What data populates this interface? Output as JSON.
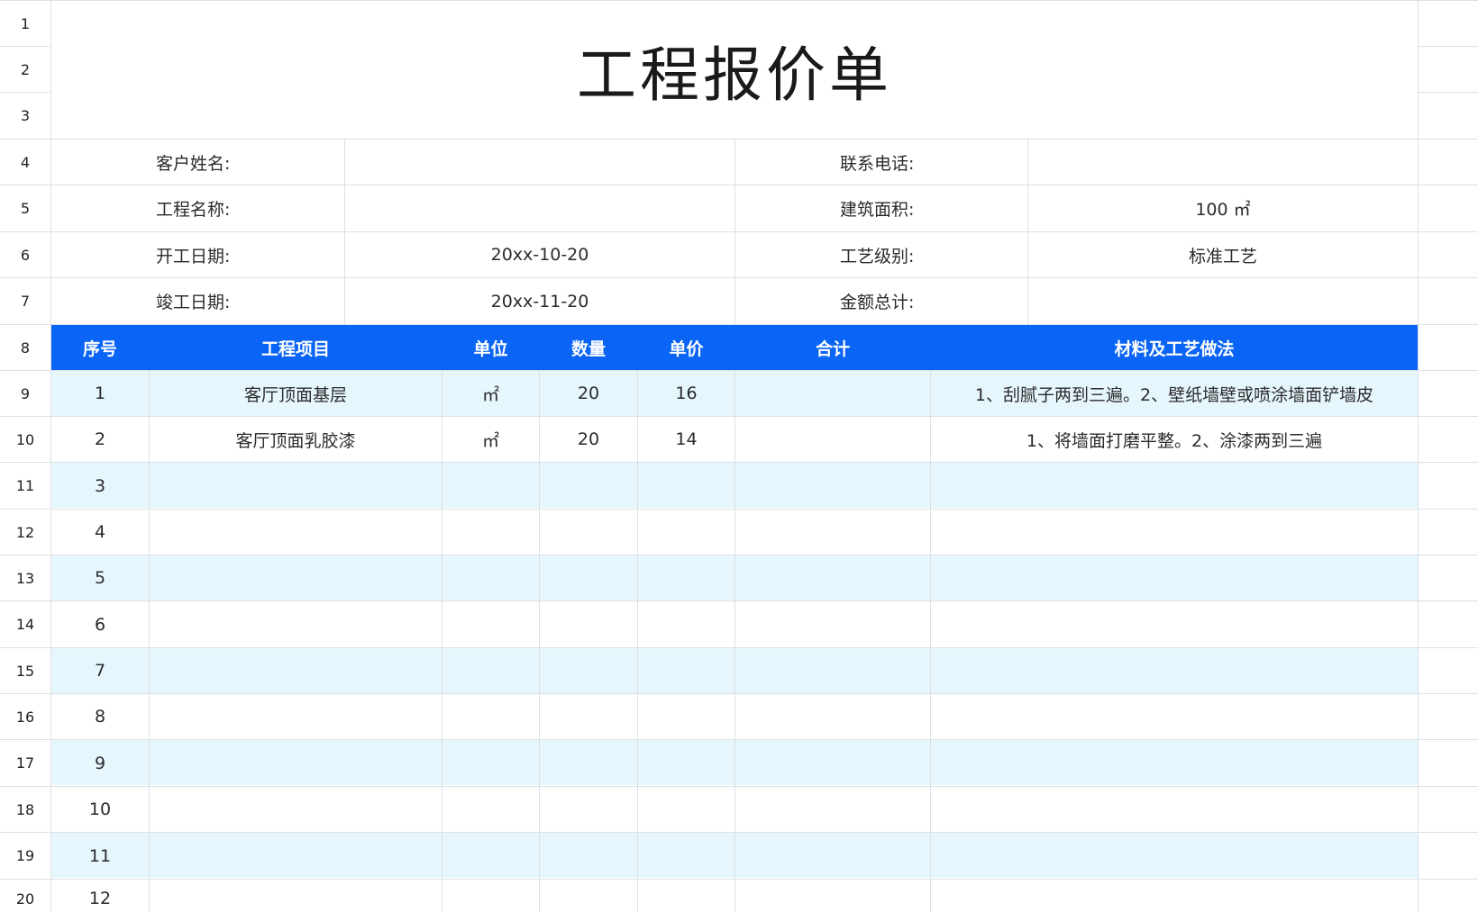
{
  "title": "工程报价单",
  "rows": [
    "1",
    "2",
    "3",
    "4",
    "5",
    "6",
    "7",
    "8",
    "9",
    "10",
    "11",
    "12",
    "13",
    "14",
    "15",
    "16",
    "17",
    "18",
    "19",
    "20"
  ],
  "info": {
    "customer_name_label": "客户姓名:",
    "customer_name_value": "",
    "phone_label": "联系电话:",
    "phone_value": "",
    "project_name_label": "工程名称:",
    "project_name_value": "",
    "area_label": "建筑面积:",
    "area_value": "100 ㎡",
    "start_date_label": "开工日期:",
    "start_date_value": "20xx-10-20",
    "craft_level_label": "工艺级别:",
    "craft_level_value": "标准工艺",
    "end_date_label": "竣工日期:",
    "end_date_value": "20xx-11-20",
    "total_label": "金额总计:",
    "total_value": ""
  },
  "table": {
    "headers": [
      "序号",
      "工程项目",
      "单位",
      "数量",
      "单价",
      "合计",
      "材料及工艺做法"
    ],
    "rows": [
      {
        "no": "1",
        "item": "客厅顶面基层",
        "unit": "㎡",
        "qty": "20",
        "price": "16",
        "sum": "",
        "method": "1、刮腻子两到三遍。2、壁纸墙壁或喷涂墙面铲墙皮"
      },
      {
        "no": "2",
        "item": "客厅顶面乳胶漆",
        "unit": "㎡",
        "qty": "20",
        "price": "14",
        "sum": "",
        "method": "1、将墙面打磨平整。2、涂漆两到三遍"
      },
      {
        "no": "3",
        "item": "",
        "unit": "",
        "qty": "",
        "price": "",
        "sum": "",
        "method": ""
      },
      {
        "no": "4",
        "item": "",
        "unit": "",
        "qty": "",
        "price": "",
        "sum": "",
        "method": ""
      },
      {
        "no": "5",
        "item": "",
        "unit": "",
        "qty": "",
        "price": "",
        "sum": "",
        "method": ""
      },
      {
        "no": "6",
        "item": "",
        "unit": "",
        "qty": "",
        "price": "",
        "sum": "",
        "method": ""
      },
      {
        "no": "7",
        "item": "",
        "unit": "",
        "qty": "",
        "price": "",
        "sum": "",
        "method": ""
      },
      {
        "no": "8",
        "item": "",
        "unit": "",
        "qty": "",
        "price": "",
        "sum": "",
        "method": ""
      },
      {
        "no": "9",
        "item": "",
        "unit": "",
        "qty": "",
        "price": "",
        "sum": "",
        "method": ""
      },
      {
        "no": "10",
        "item": "",
        "unit": "",
        "qty": "",
        "price": "",
        "sum": "",
        "method": ""
      },
      {
        "no": "11",
        "item": "",
        "unit": "",
        "qty": "",
        "price": "",
        "sum": "",
        "method": ""
      },
      {
        "no": "12",
        "item": "",
        "unit": "",
        "qty": "",
        "price": "",
        "sum": "",
        "method": ""
      }
    ]
  },
  "colors": {
    "header_bg": "#0a64f5",
    "stripe_bg": "#e6f6fd",
    "grid_line": "#dcdfe4"
  }
}
